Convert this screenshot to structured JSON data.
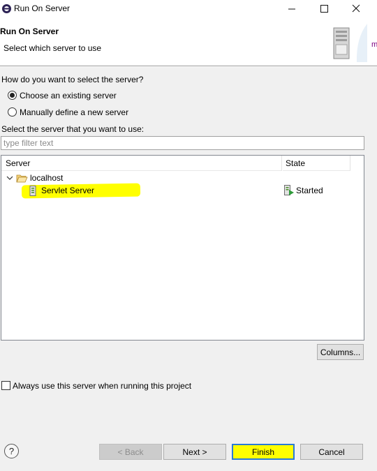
{
  "window": {
    "title": "Run On Server",
    "controls": {
      "minimize": "minimize",
      "maximize": "maximize",
      "close": "close"
    }
  },
  "header": {
    "title": "Run On Server",
    "subtitle": "Select which server to use",
    "edge_glyph": "m"
  },
  "selection": {
    "question": "How do you want to select the server?",
    "options": [
      {
        "label": "Choose an existing server",
        "selected": true
      },
      {
        "label": "Manually define a new server",
        "selected": false
      }
    ]
  },
  "server_list": {
    "label": "Select the server that you want to use:",
    "filter_placeholder": "type filter text",
    "filter_value": "",
    "columns": [
      "Server",
      "State"
    ],
    "tree": {
      "host": "localhost",
      "expanded": true,
      "servers": [
        {
          "name": "Servlet Server",
          "state": "Started",
          "highlighted": true
        }
      ]
    },
    "columns_button": "Columns..."
  },
  "always_use": {
    "label": "Always use this server when running this project",
    "checked": false
  },
  "footer": {
    "help": "?",
    "back": "< Back",
    "next": "Next >",
    "finish": "Finish",
    "cancel": "Cancel"
  },
  "colors": {
    "highlight": "#ffff00",
    "focus_border": "#2a7bd6",
    "started_green": "#2e9b3a"
  }
}
